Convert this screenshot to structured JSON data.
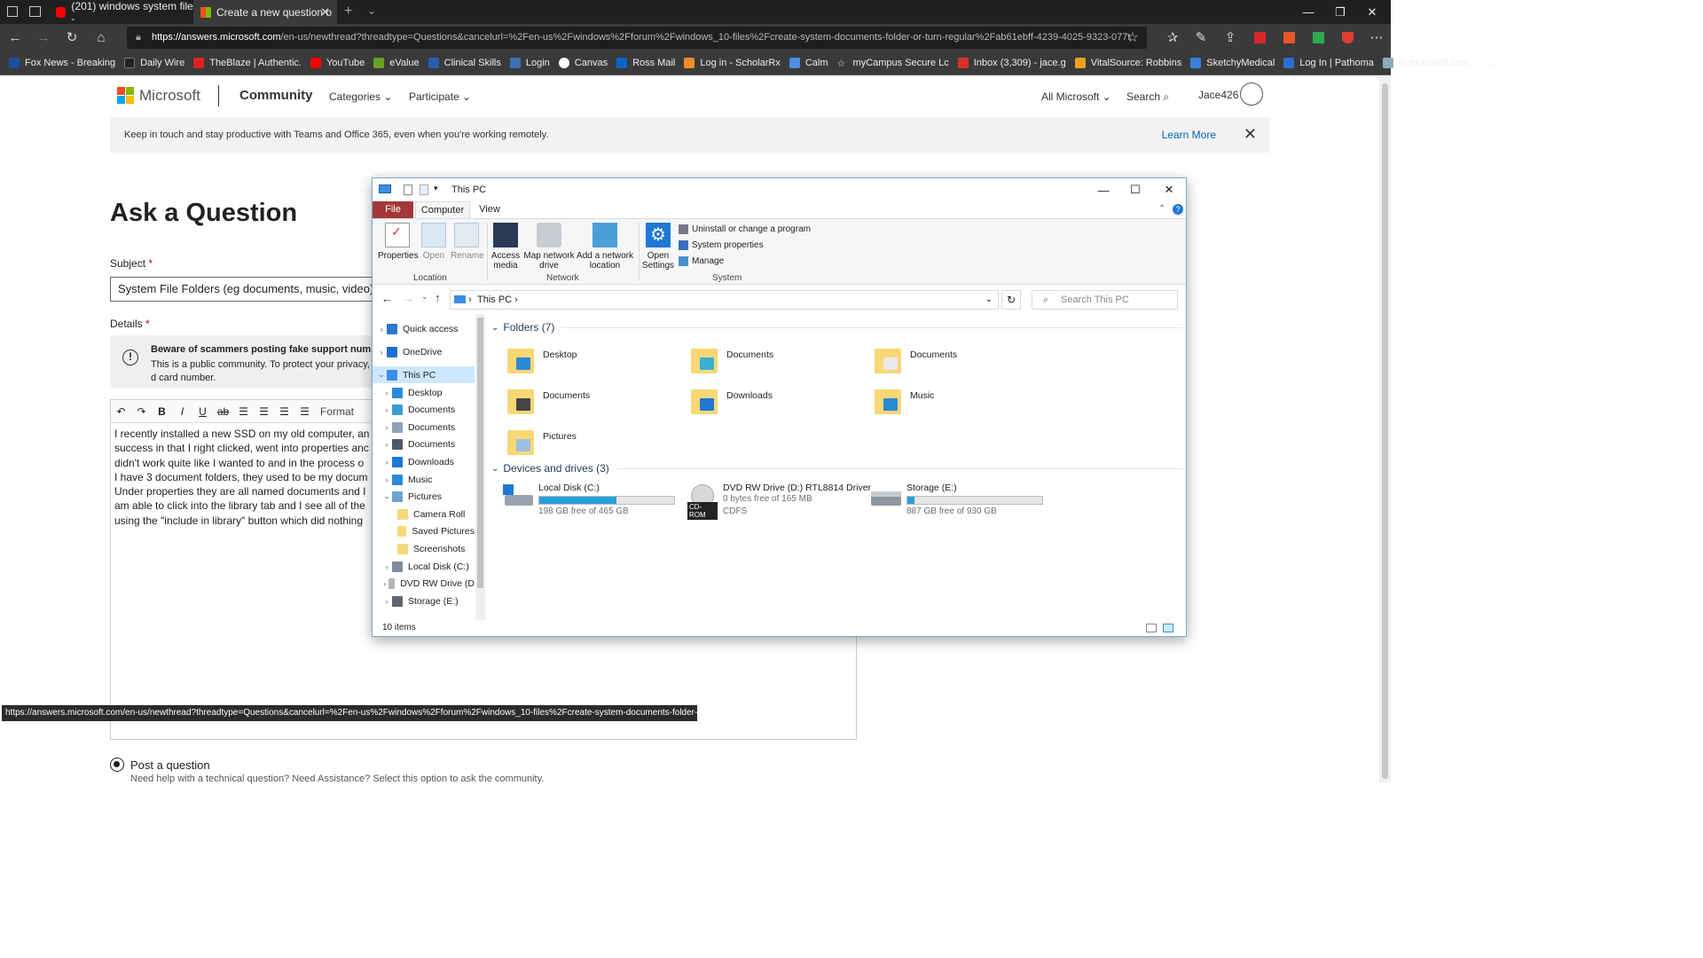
{
  "browser": {
    "tabs": [
      {
        "title": "(201) windows system file -"
      },
      {
        "title": "Create a new question o"
      }
    ],
    "url_host": "https://answers.microsoft.com",
    "url_rest": "/en-us/newthread?threadtype=Questions&cancelurl=%2Fen-us%2Fwindows%2Fforum%2Fwindows_10-files%2Fcreate-system-documents-folder-or-turn-regular%2Fab61ebff-4239-4025-9323-077t",
    "bookmarks": [
      "Fox News - Breaking",
      "Daily Wire",
      "TheBlaze | Authentic.",
      "YouTube",
      "eValue",
      "Clinical Skills",
      "Login",
      "Canvas",
      "Ross Mail",
      "Log in - ScholarRx",
      "Calm",
      "myCampus Secure Lc",
      "Inbox (3,309) - jace.g",
      "VitalSource: Robbins",
      "SketchyMedical",
      "Log In | Pathoma",
      "ei.examsoft.com"
    ]
  },
  "page": {
    "brand": "Microsoft",
    "community": "Community",
    "nav": [
      "Categories",
      "Participate"
    ],
    "all_microsoft": "All Microsoft",
    "search": "Search",
    "user": "Jace426",
    "banner_text": "Keep in touch and stay productive with Teams and Office 365, even when you're working remotely.",
    "banner_link": "Learn More",
    "title": "Ask a Question",
    "subject_label": "Subject",
    "subject_value": "System File Folders (eg documents, music, video)",
    "details_label": "Details",
    "warn_title": "Beware of scammers posting fake support numbers",
    "warn_body": "This is a public community. To protect your privacy, d card number.",
    "format_label": "Format",
    "body_lines": [
      "I recently installed a new SSD on my old computer, an",
      "success in that I right clicked, went into properties anc",
      "didn't work quite like I wanted to and in the process o",
      "I have 3 document folders, they used to be my docum",
      "Under properties they are all named documents and I",
      "am able to click into the library tab and I see all of the",
      "using the \"include in library\" button which did nothing"
    ],
    "status_url": "https://answers.microsoft.com/en-us/newthread?threadtype=Questions&cancelurl=%2Fen-us%2Fwindows%2Fforum%2Fwindows_10-files%2Fcreate-system-documents-folder-or-t",
    "post_label": "Post a question",
    "post_sub": "Need help with a technical question? Need Assistance? Select this option to ask the community."
  },
  "explorer": {
    "title": "This PC",
    "tabs": [
      "File",
      "Computer",
      "View"
    ],
    "ribbon": {
      "properties": "Properties",
      "open": "Open",
      "rename": "Rename",
      "access_media": "Access\nmedia",
      "map_drive": "Map network\ndrive",
      "add_location": "Add a network\nlocation",
      "open_settings": "Open\nSettings",
      "uninstall": "Uninstall or change a program",
      "sys_props": "System properties",
      "manage": "Manage",
      "groups": [
        "Location",
        "Network",
        "System"
      ]
    },
    "address": "This PC",
    "search_placeholder": "Search This PC",
    "nav_items": [
      {
        "label": "Quick access",
        "color": "#2b78d0",
        "level": 0
      },
      {
        "label": "OneDrive",
        "color": "#1e6fd0",
        "level": 0
      },
      {
        "label": "This PC",
        "color": "#3a8ee6",
        "level": 0
      },
      {
        "label": "Desktop",
        "color": "#2b88d8",
        "level": 1
      },
      {
        "label": "Documents",
        "color": "#3a9bd5",
        "level": 1
      },
      {
        "label": "Documents",
        "color": "#8fa3b8",
        "level": 1
      },
      {
        "label": "Documents",
        "color": "#4a5a6a",
        "level": 1
      },
      {
        "label": "Downloads",
        "color": "#1e78d6",
        "level": 1
      },
      {
        "label": "Music",
        "color": "#2a8ad8",
        "level": 1
      },
      {
        "label": "Pictures",
        "color": "#6fa3d2",
        "level": 1
      },
      {
        "label": "Camera Roll",
        "color": "#f5d97a",
        "level": 2
      },
      {
        "label": "Saved Pictures",
        "color": "#f5d97a",
        "level": 2
      },
      {
        "label": "Screenshots",
        "color": "#f5d97a",
        "level": 2
      },
      {
        "label": "Local Disk (C:)",
        "color": "#7f8c99",
        "level": 1
      },
      {
        "label": "DVD RW Drive (D",
        "color": "#b5b5b5",
        "level": 1
      },
      {
        "label": "Storage (E:)",
        "color": "#5b6671",
        "level": 1
      }
    ],
    "folders_header": "Folders (7)",
    "folders": [
      {
        "name": "Desktop",
        "overlay": "#2b88d8"
      },
      {
        "name": "Documents",
        "overlay": "#3ab0d5"
      },
      {
        "name": "Documents",
        "overlay": "#e8e8e8"
      },
      {
        "name": "Documents",
        "overlay": "#444444"
      },
      {
        "name": "Downloads",
        "overlay": "#1e78d6"
      },
      {
        "name": "Music",
        "overlay": "#2a8ad8"
      },
      {
        "name": "Pictures",
        "overlay": "#9ac0e0"
      }
    ],
    "drives_header": "Devices and drives (3)",
    "drives": [
      {
        "name": "Local Disk (C:)",
        "space": "198 GB free of 465 GB",
        "used": 0.57,
        "bar": true
      },
      {
        "name": "DVD RW Drive (D:) RTL8814 Driver",
        "space": "0 bytes free of 165 MB",
        "fs": "CDFS",
        "bar": false
      },
      {
        "name": "Storage (E:)",
        "space": "887 GB free of 930 GB",
        "used": 0.05,
        "bar": true
      }
    ],
    "cdrom_label": "CD-ROM",
    "status": "10 items"
  }
}
